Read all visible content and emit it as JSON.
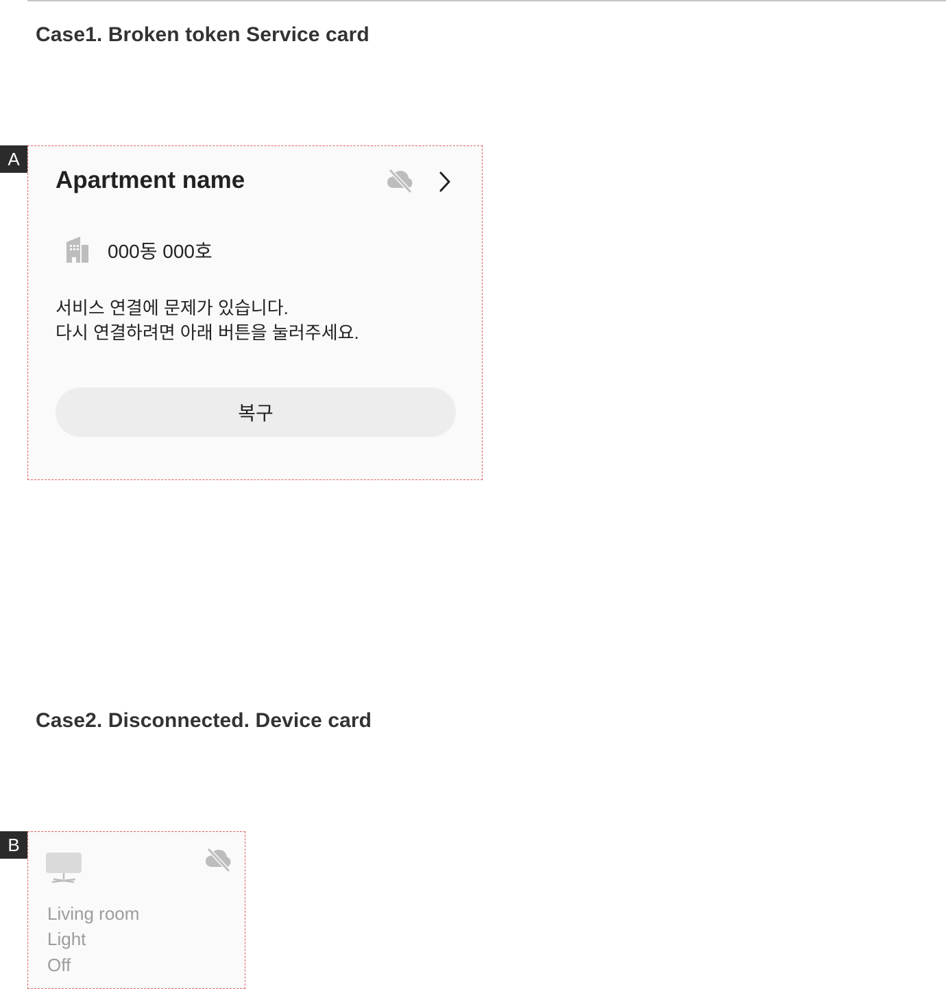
{
  "sections": {
    "case1_title": "Case1. Broken token Service card",
    "case2_title": "Case2. Disconnected. Device card"
  },
  "markers": {
    "a": "A",
    "b": "B"
  },
  "service_card": {
    "title": "Apartment name",
    "unit": "000동 000호",
    "message_line1": "서비스 연결에 문제가 있습니다.",
    "message_line2": "다시 연결하려면 아래 버튼을 눌러주세요.",
    "restore_button_label": "복구",
    "icons": [
      "cloud-off-icon",
      "chevron-right-icon",
      "building-icon"
    ]
  },
  "device_card": {
    "room": "Living room",
    "device": "Light",
    "state": "Off",
    "icons": [
      "tv-icon",
      "cloud-off-icon"
    ]
  },
  "colors": {
    "card_background": "#fafafa",
    "card_outline": "#e06060",
    "button_background": "#ededed",
    "icon_gray": "#bdbdbd",
    "disabled_text": "#9c9c9c",
    "marker_background": "#2b2b2b"
  }
}
